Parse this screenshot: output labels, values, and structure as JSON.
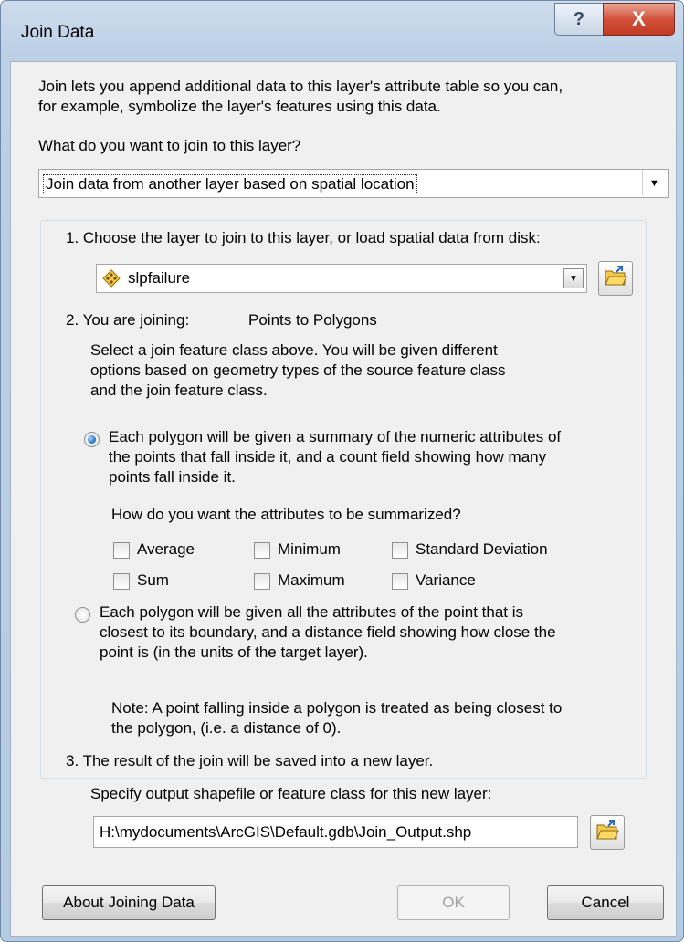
{
  "window": {
    "title": "Join Data",
    "help_glyph": "?",
    "close_glyph": "X"
  },
  "intro": {
    "line1": "Join lets you append additional data to this layer's attribute table so you can,",
    "line2": "for example, symbolize the layer's features using this data."
  },
  "join_type": {
    "label": "What do you want to join to this layer?",
    "selected": "Join data from another layer based on spatial location"
  },
  "step1": {
    "label": "1.  Choose the layer to join to this layer, or load spatial data from disk:",
    "layer": "slpfailure",
    "layer_icon": "point-layer-icon"
  },
  "step2": {
    "label": "2.  You are joining:",
    "joining_value": "Points to Polygons",
    "desc1": "Select a join feature class above.  You will be given different",
    "desc2": "options based on geometry types of the source feature class",
    "desc3": "and the join feature class.",
    "option1": {
      "line1": "Each polygon will be given a summary of the numeric attributes of",
      "line2": "the points that fall inside it, and a count field showing how many",
      "line3": "points fall inside it.",
      "selected": true
    },
    "summarize_question": "How do you want the attributes to be summarized?",
    "checkboxes": [
      {
        "label": "Average",
        "checked": false
      },
      {
        "label": "Minimum",
        "checked": false
      },
      {
        "label": "Standard Deviation",
        "checked": false
      },
      {
        "label": "Sum",
        "checked": false
      },
      {
        "label": "Maximum",
        "checked": false
      },
      {
        "label": "Variance",
        "checked": false
      }
    ],
    "option2": {
      "line1": "Each polygon will be given all the attributes of the point that is",
      "line2": "closest to its boundary, and a distance field showing how close the",
      "line3": "point is (in the units of the target layer).",
      "selected": false
    },
    "note1": "Note: A point falling inside a polygon is treated as being closest to",
    "note2": "the polygon, (i.e. a distance of 0)."
  },
  "step3": {
    "label": "3.  The result of the join will be saved into a new layer.",
    "output_label": "Specify output shapefile or feature class for this new layer:",
    "output_path": "H:\\mydocuments\\ArcGIS\\Default.gdb\\Join_Output.shp"
  },
  "buttons": {
    "about": "About Joining Data",
    "ok": "OK",
    "cancel": "Cancel"
  },
  "colors": {
    "accent_radio": "#1f6bc4",
    "folder_yellow": "#f2c94c",
    "close_red": "#c23a22"
  }
}
